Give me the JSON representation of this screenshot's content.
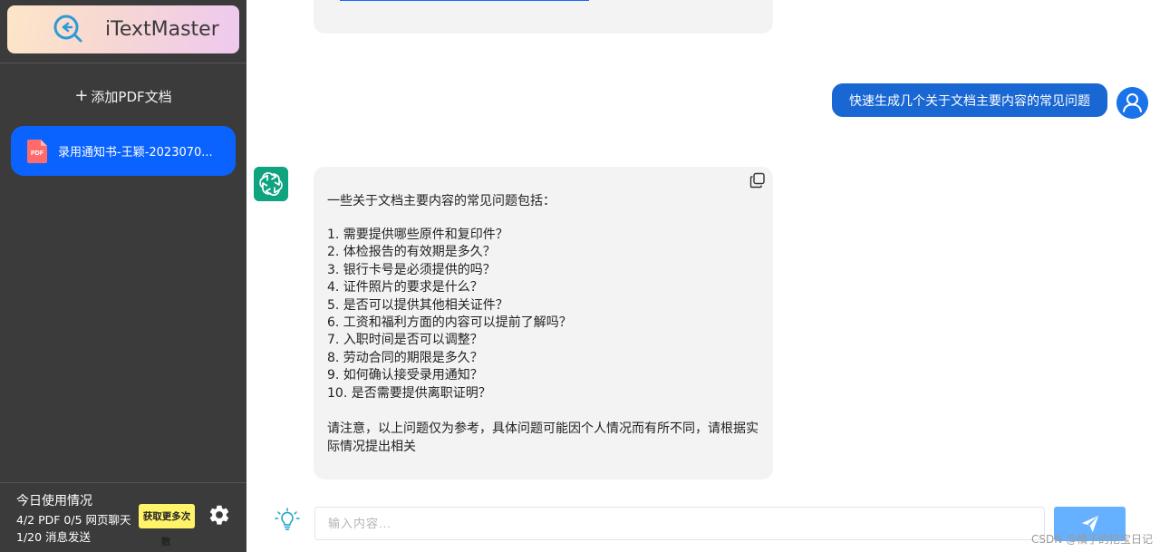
{
  "app": {
    "name": "iTextMaster"
  },
  "sidebar": {
    "add_doc_label": "添加PDF文档",
    "documents": [
      {
        "name": "录用通知书-王颖-2023070...",
        "badge": "PDF"
      }
    ],
    "usage": {
      "title": "今日使用情况",
      "line1": "4/2 PDF  0/5 网页聊天",
      "line2": "1/20 消息发送",
      "more_button_label": "获取更多次",
      "more_button_tail": "数"
    }
  },
  "chat": {
    "user_message": "快速生成几个关于文档主要内容的常见问题",
    "bot_intro": "一些关于文档主要内容的常见问题包括：",
    "bot_items": [
      "1. 需要提供哪些原件和复印件？",
      "2. 体检报告的有效期是多久？",
      "3. 银行卡号是必须提供的吗？",
      "4. 证件照片的要求是什么？",
      "5. 是否可以提供其他相关证件？",
      "6. 工资和福利方面的内容可以提前了解吗？",
      "7. 入职时间是否可以调整？",
      "8. 劳动合同的期限是多久？",
      "9. 如何确认接受录用通知？",
      "10. 是否需要提供离职证明？"
    ],
    "bot_note": "请注意，以上问题仅为参考，具体问题可能因个人情况而有所不同，请根据实际情况提出相关",
    "input_placeholder": "输入内容..."
  },
  "watermark": "CSDN @橘子的挖宝日记",
  "colors": {
    "sidebar_bg": "#3b3b3b",
    "accent": "#0b63ff",
    "user_bubble": "#1967d2",
    "bot_avatar": "#10a37f",
    "send_button": "#66b1ff",
    "more_button": "#fff36a"
  },
  "icons": [
    "logo-icon",
    "plus-icon",
    "pdf-icon",
    "gear-icon",
    "user-avatar-icon",
    "openai-icon",
    "copy-icon",
    "lightbulb-icon",
    "send-icon"
  ]
}
